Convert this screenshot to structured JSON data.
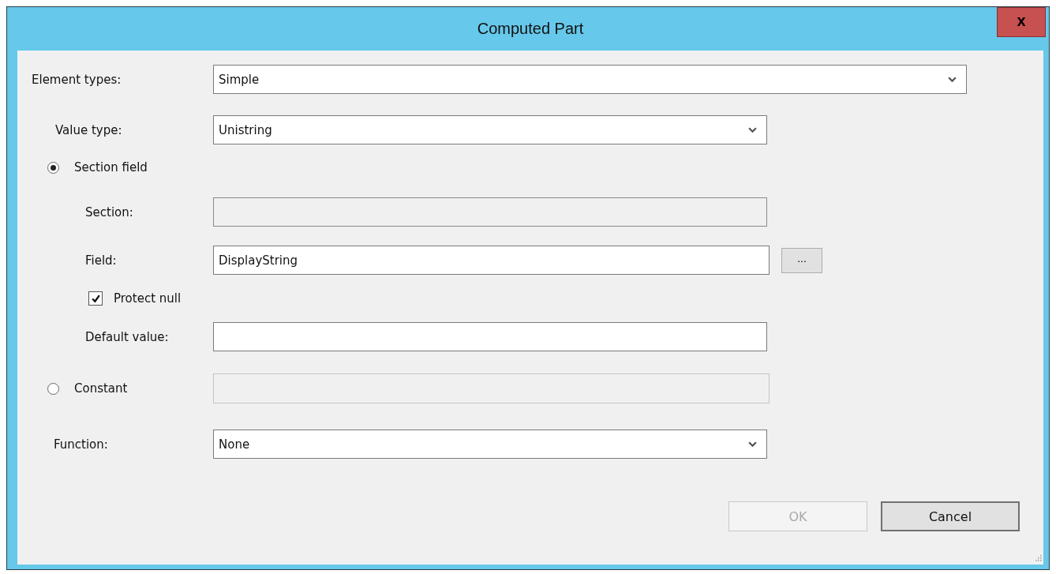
{
  "window": {
    "title": "Computed Part",
    "close_label": "x"
  },
  "element_types": {
    "label": "Element types:",
    "value": "Simple"
  },
  "value_type": {
    "label": "Value type:",
    "value": "Unistring"
  },
  "section_field": {
    "label": "Section field",
    "selected": true,
    "section": {
      "label": "Section:",
      "read_only": true
    },
    "field": {
      "label": "Field:",
      "value": "DisplayString",
      "browse_label": "..."
    },
    "protect_null": {
      "label": "Protect null",
      "checked": true
    },
    "default_value": {
      "label": "Default value:"
    }
  },
  "constant": {
    "label": "Constant",
    "selected": false,
    "disabled": true
  },
  "function": {
    "label": "Function:",
    "value": "None"
  },
  "buttons": [
    {
      "label": "OK",
      "disabled": true
    },
    {
      "label": "Cancel",
      "disabled": false
    }
  ]
}
